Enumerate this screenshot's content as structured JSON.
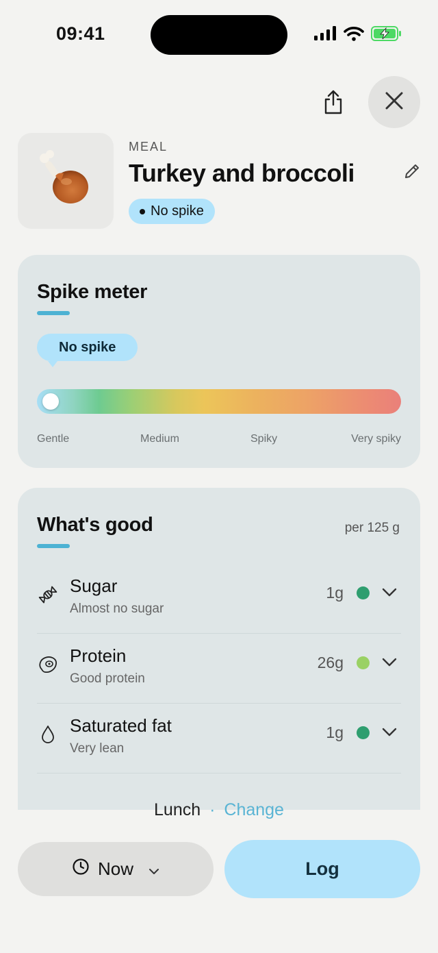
{
  "status_bar": {
    "time": "09:41",
    "icons": [
      "cellular-signal-icon",
      "wifi-icon",
      "battery-charging-icon"
    ],
    "battery_color": "#4cd964"
  },
  "header": {
    "icons": [
      "share-icon",
      "close-icon"
    ]
  },
  "meal": {
    "kicker": "MEAL",
    "title": "Turkey and broccoli",
    "image_icon": "turkey-drumstick-icon",
    "badge": "No spike",
    "edit_icon": "pencil-icon"
  },
  "spike_meter": {
    "title": "Spike meter",
    "bubble": "No spike",
    "level": 0.0,
    "labels": [
      "Gentle",
      "Medium",
      "Spiky",
      "Very spiky"
    ],
    "accent_color": "#4db2d3"
  },
  "whats_good": {
    "title": "What's good",
    "per": "per 125 g",
    "items": [
      {
        "name": "Sugar",
        "sub": "Almost no sugar",
        "value": "1g",
        "dot_color": "#2e9e6f",
        "icon": "candy-icon"
      },
      {
        "name": "Protein",
        "sub": "Good protein",
        "value": "26g",
        "dot_color": "#9ad164",
        "icon": "steak-icon"
      },
      {
        "name": "Saturated fat",
        "sub": "Very lean",
        "value": "1g",
        "dot_color": "#2e9e6f",
        "icon": "droplet-icon"
      }
    ]
  },
  "footer": {
    "meal_type": "Lunch",
    "separator": "·",
    "change_label": "Change",
    "time_button": "Now",
    "log_button": "Log"
  }
}
